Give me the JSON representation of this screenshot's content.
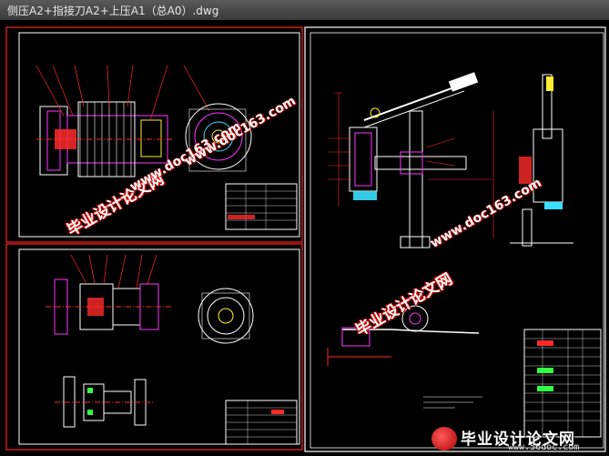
{
  "window": {
    "title": "侧压A2+指接刀A2+上压A1（总A0）.dwg"
  },
  "watermarks": {
    "cn_text": "毕业设计论文网",
    "url_text": "www.doc163.com"
  },
  "logo": {
    "text": "毕业设计论文网",
    "url": "www.56doc.com"
  },
  "colors": {
    "border": "#ff2020",
    "frame": "#ffffff",
    "part_red": "#ff2a2a",
    "part_magenta": "#ff33ff",
    "part_cyan": "#39e0ff",
    "part_yellow": "#ffee33",
    "part_green": "#33ff44"
  }
}
